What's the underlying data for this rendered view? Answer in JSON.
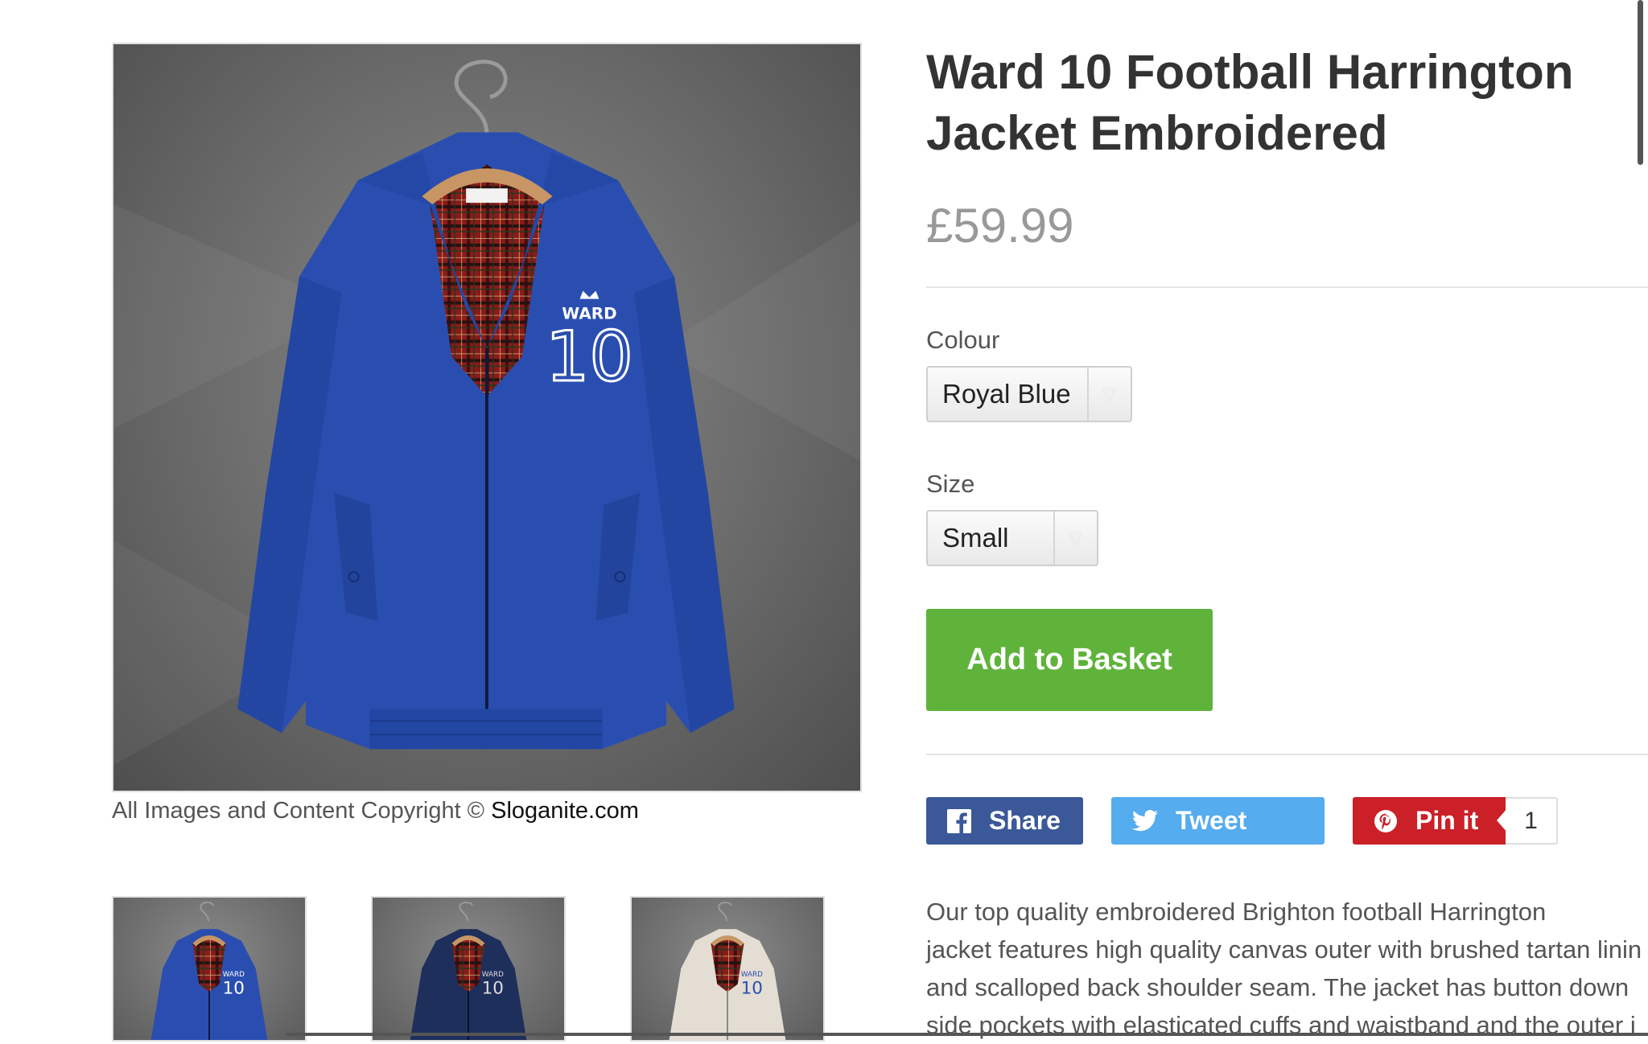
{
  "product": {
    "title": "Ward 10 Football Harrington Jacket Embroidered",
    "price": "£59.99",
    "image_copyright_prefix": "All Images and Content Copyright ©",
    "image_copyright_brand": "Sloganite.com",
    "embroidery_word": "WARD",
    "embroidery_number": "10",
    "main_color": "#2a4eb0"
  },
  "options": {
    "colour": {
      "label": "Colour",
      "selected": "Royal Blue"
    },
    "size": {
      "label": "Size",
      "selected": "Small"
    }
  },
  "actions": {
    "add_to_basket": "Add to Basket"
  },
  "social": {
    "share": {
      "label": "Share",
      "icon": "facebook-icon",
      "color": "#3b5998"
    },
    "tweet": {
      "label": "Tweet",
      "icon": "twitter-icon",
      "color": "#55acee"
    },
    "pin": {
      "label": "Pin it",
      "icon": "pinterest-icon",
      "color": "#cb2027",
      "count": "1"
    }
  },
  "thumbnails": [
    {
      "name": "royal-blue",
      "color": "#2a4eb0"
    },
    {
      "name": "navy",
      "color": "#1f2f5c"
    },
    {
      "name": "stone",
      "color": "#e3ddd3"
    }
  ],
  "description": [
    "Our top quality embroidered Brighton football Harrington",
    "jacket features high quality canvas outer with brushed tartan linin",
    "and scalloped back shoulder seam. The jacket has button down",
    "side pockets with elasticated cuffs and waistband and the outer i"
  ]
}
